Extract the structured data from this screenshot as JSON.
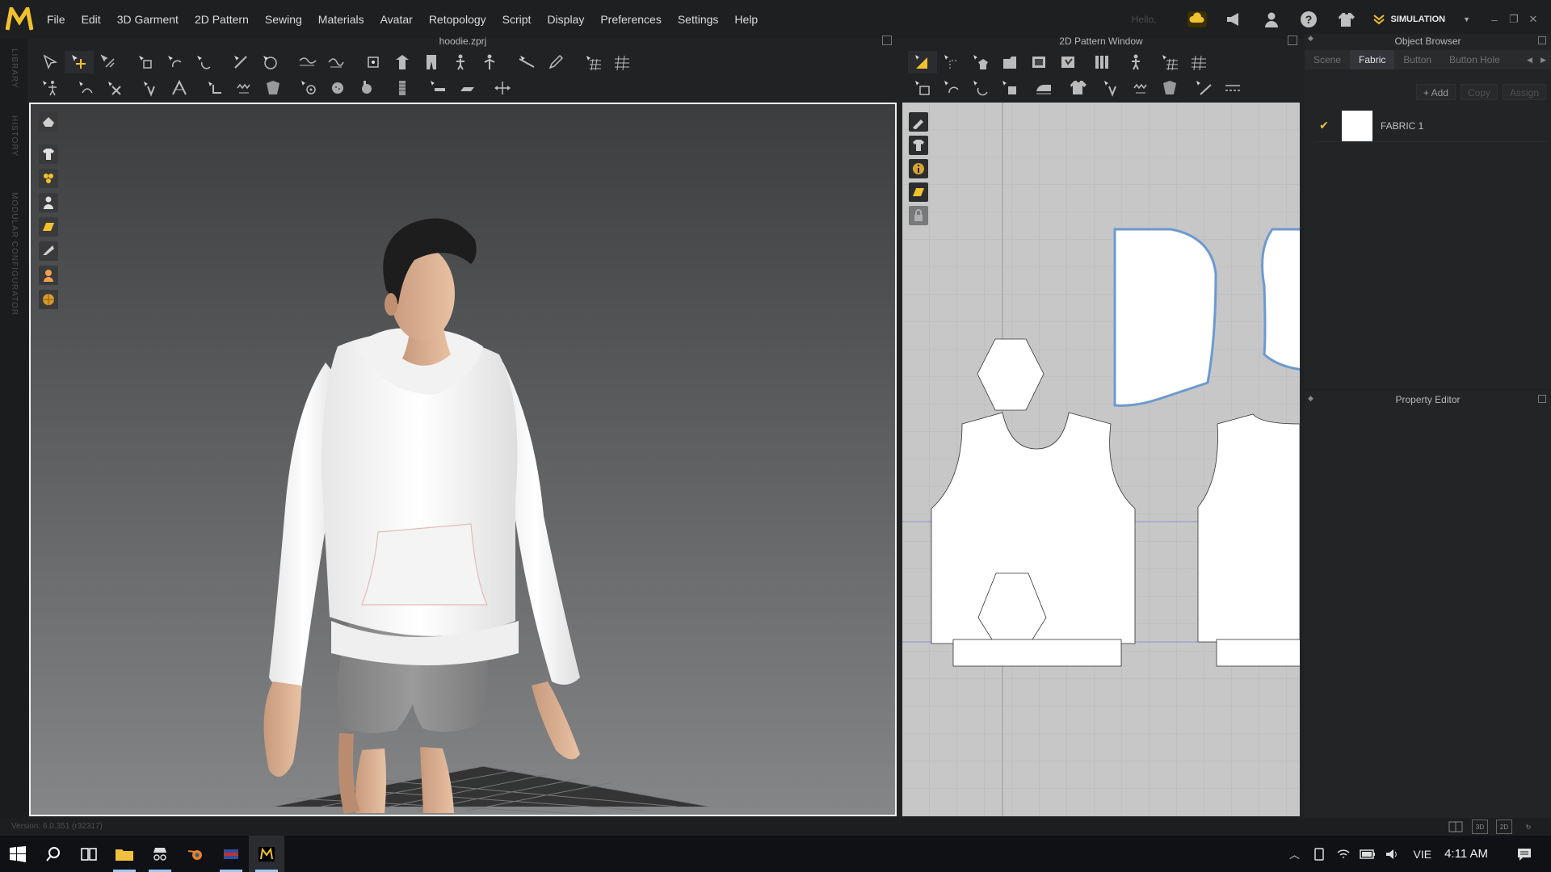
{
  "app": {
    "title": "hoodie.zprj",
    "menu": [
      "File",
      "Edit",
      "3D Garment",
      "2D Pattern",
      "Sewing",
      "Materials",
      "Avatar",
      "Retopology",
      "Script",
      "Display",
      "Preferences",
      "Settings",
      "Help"
    ],
    "greeting": "Hello,",
    "mode_label": "SIMULATION",
    "accent": "#f2c12e"
  },
  "side_labels": [
    "LIBRARY",
    "HISTORY",
    "MODULAR CONFIGURATOR"
  ],
  "panels": {
    "viewport_title": "hoodie.zprj",
    "pattern_title": "2D Pattern Window",
    "object_browser": {
      "title": "Object Browser",
      "tabs": [
        "Scene",
        "Fabric",
        "Button",
        "Button Hole"
      ],
      "active_tab": "Fabric",
      "actions": {
        "add": "+ Add",
        "copy": "Copy",
        "assign": "Assign"
      },
      "fabrics": [
        {
          "name": "FABRIC 1",
          "color": "#ffffff",
          "checked": true
        }
      ]
    },
    "property_editor": {
      "title": "Property Editor"
    }
  },
  "status": {
    "version": "Version: 6.0.351 (r32317)",
    "view_modes": [
      "",
      "3D",
      "2D",
      ""
    ]
  },
  "taskbar": {
    "language": "VIE",
    "time": "4:11 AM"
  }
}
